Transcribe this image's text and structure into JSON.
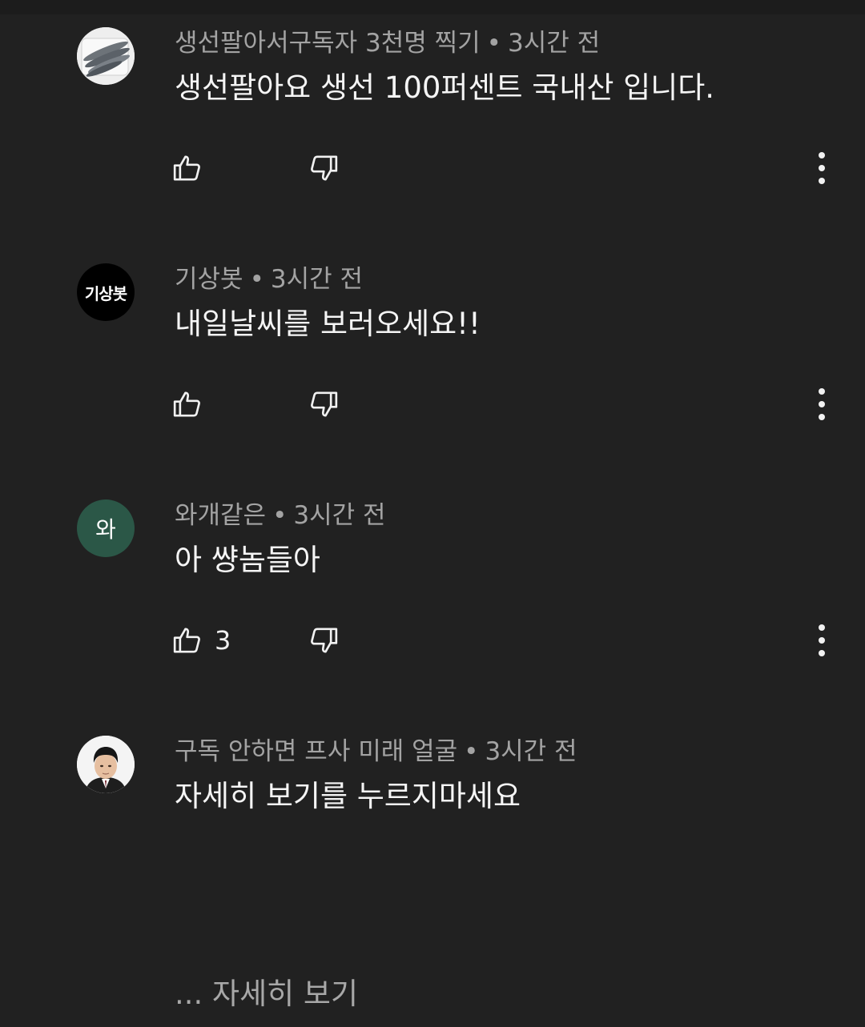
{
  "comments": [
    {
      "author": "생선팔아서구독자 3천명 찍기",
      "time": "3시간 전",
      "text": "생선팔아요 생선 100퍼센트 국내산 입니다.",
      "likes": "",
      "avatar": {
        "type": "image",
        "desc": "fish-avatar",
        "bg": "#e8e8e8"
      }
    },
    {
      "author": "기상봇",
      "time": "3시간 전",
      "text": "내일날씨를 보러오세요!!",
      "likes": "",
      "avatar": {
        "type": "text",
        "label": "기상봇",
        "bg": "#000000"
      }
    },
    {
      "author": "와개같은",
      "time": "3시간 전",
      "text": "아 썅놈들아",
      "likes": "3",
      "avatar": {
        "type": "text",
        "label": "와",
        "bg": "#2b5747"
      }
    },
    {
      "author": "구독 안하면 프사 미래 얼굴",
      "time": "3시간 전",
      "text": "자세히 보기를 누르지마세요",
      "likes": "",
      "avatar": {
        "type": "image",
        "desc": "portrait-avatar",
        "bg": "#f2f2f2"
      }
    }
  ],
  "separator": "•",
  "read_more": "... 자세히 보기",
  "icons": {
    "like": "thumbs-up-icon",
    "dislike": "thumbs-down-icon",
    "more": "vertical-ellipsis-icon"
  },
  "colors": {
    "background": "#212121",
    "meta_text": "#a3a3a3",
    "body_text": "#f5f5f5"
  }
}
